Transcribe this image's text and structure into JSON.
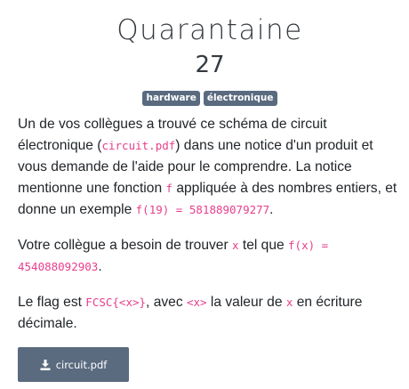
{
  "challenge": {
    "title": "Quarantaine",
    "points": "27",
    "tags": [
      "hardware",
      "électronique"
    ]
  },
  "description": {
    "p1": {
      "t1": "Un de vos collègues a trouvé ce schéma de circuit électronique (",
      "c1": "circuit.pdf",
      "t2": ") dans une notice d'un produit et vous demande de l'aide pour le comprendre. La notice mentionne une fonction ",
      "c2": "f",
      "t3": " appliquée à des nombres entiers, et donne un exemple ",
      "c3": "f(19) = 581889079277",
      "t4": "."
    },
    "p2": {
      "t1": "Votre collègue a besoin de trouver ",
      "c1": "x",
      "t2": " tel que ",
      "c2": "f(x) = 454088092903",
      "t3": "."
    },
    "p3": {
      "t1": "Le flag est ",
      "c1": "FCSC{<x>}",
      "t2": ", avec ",
      "c2": "<x>",
      "t3": " la valeur de ",
      "c3": "x",
      "t4": " en écriture décimale."
    }
  },
  "download": {
    "label": "circuit.pdf",
    "icon": "download-icon"
  },
  "colors": {
    "accent": "#5a6a7f",
    "code": "#e83e8c",
    "text": "#212529"
  }
}
